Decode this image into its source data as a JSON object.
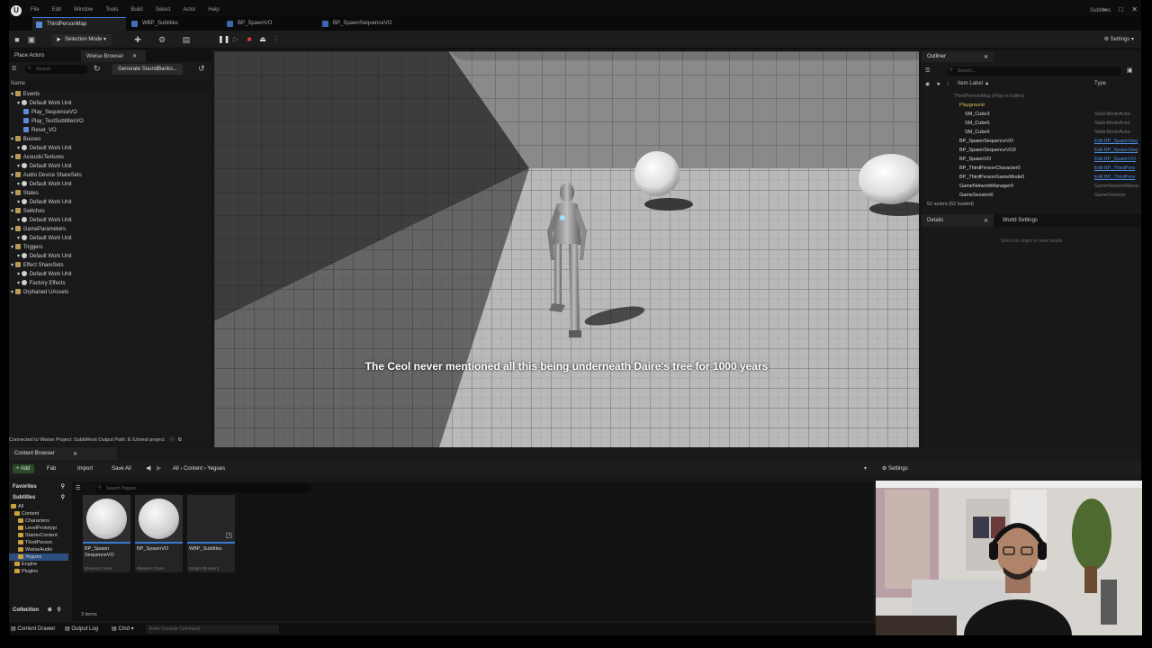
{
  "menubar": {
    "items": [
      "File",
      "Edit",
      "Window",
      "Tools",
      "Build",
      "Select",
      "Actor",
      "Help"
    ],
    "right_label": "Subtitles"
  },
  "tabs": [
    {
      "label": "ThirdPersonMap",
      "active": true
    },
    {
      "label": "WBP_Subtitles",
      "active": false
    },
    {
      "label": "BP_SpawnVO",
      "active": false
    },
    {
      "label": "BP_SpawnSequenceVO",
      "active": false
    }
  ],
  "toolbar": {
    "selection_mode": "Selection Mode",
    "settings_label": "Settings"
  },
  "left_panel": {
    "tab_place_actors": "Place Actors",
    "tab_wwise": "Wwise Browser",
    "search_placeholder": "Search",
    "generate_button": "Generate SoundBanks...",
    "column_name": "Name",
    "tree": [
      {
        "label": "Events",
        "depth": 0,
        "kind": "folder"
      },
      {
        "label": "Default Work Unit",
        "depth": 1,
        "kind": "wu"
      },
      {
        "label": "Play_SequenceVO",
        "depth": 2,
        "kind": "event"
      },
      {
        "label": "Play_TestSubtitlesVO",
        "depth": 2,
        "kind": "event"
      },
      {
        "label": "Reset_VO",
        "depth": 2,
        "kind": "event"
      },
      {
        "label": "Busses",
        "depth": 0,
        "kind": "folder"
      },
      {
        "label": "Default Work Unit",
        "depth": 1,
        "kind": "wu"
      },
      {
        "label": "AcousticTextures",
        "depth": 0,
        "kind": "folder"
      },
      {
        "label": "Default Work Unit",
        "depth": 1,
        "kind": "wu"
      },
      {
        "label": "Audio Device ShareSets",
        "depth": 0,
        "kind": "folder"
      },
      {
        "label": "Default Work Unit",
        "depth": 1,
        "kind": "wu"
      },
      {
        "label": "States",
        "depth": 0,
        "kind": "folder"
      },
      {
        "label": "Default Work Unit",
        "depth": 1,
        "kind": "wu"
      },
      {
        "label": "Switches",
        "depth": 0,
        "kind": "folder"
      },
      {
        "label": "Default Work Unit",
        "depth": 1,
        "kind": "wu"
      },
      {
        "label": "GameParameters",
        "depth": 0,
        "kind": "folder"
      },
      {
        "label": "Default Work Unit",
        "depth": 1,
        "kind": "wu"
      },
      {
        "label": "Triggers",
        "depth": 0,
        "kind": "folder"
      },
      {
        "label": "Default Work Unit",
        "depth": 1,
        "kind": "wu"
      },
      {
        "label": "Effect ShareSets",
        "depth": 0,
        "kind": "folder"
      },
      {
        "label": "Default Work Unit",
        "depth": 1,
        "kind": "wu"
      },
      {
        "label": "Factory Effects",
        "depth": 1,
        "kind": "wu"
      },
      {
        "label": "Orphaned UAssets",
        "depth": 0,
        "kind": "folder"
      }
    ],
    "connection_status": "Connected to Wwise Project: SubtitRoot Output Path: E:/Unreal project"
  },
  "viewport": {
    "subtitle": "The Ceol never mentioned all this being underneath Daire's tree for 1000 years"
  },
  "outliner": {
    "tab_label": "Outliner",
    "search_placeholder": "Search...",
    "col_label": "Item Label ▲",
    "col_type": "Type",
    "rows": [
      {
        "label": "ThirdPersonMap (Play in Editor)",
        "type": "",
        "indent": 1,
        "dim": true,
        "link": false
      },
      {
        "label": "Playground",
        "type": "",
        "indent": 2,
        "dim": false,
        "link": false
      },
      {
        "label": "SM_Cube3",
        "type": "StaticMeshActor",
        "indent": 3,
        "dim": false,
        "link": false
      },
      {
        "label": "SM_Cube5",
        "type": "StaticMeshActor",
        "indent": 3,
        "dim": false,
        "link": false
      },
      {
        "label": "SM_Cube6",
        "type": "StaticMeshActor",
        "indent": 3,
        "dim": false,
        "link": false
      },
      {
        "label": "BP_SpawnSequenceVO",
        "type": "Edit BP_SpawnSeq",
        "indent": 2,
        "dim": false,
        "link": true
      },
      {
        "label": "BP_SpawnSequenceVO2",
        "type": "Edit BP_SpawnSeq",
        "indent": 2,
        "dim": false,
        "link": true
      },
      {
        "label": "BP_SpawnVO",
        "type": "Edit BP_SpawnVO",
        "indent": 2,
        "dim": false,
        "link": true
      },
      {
        "label": "BP_ThirdPersonCharacter0",
        "type": "Edit BP_ThirdPers",
        "indent": 2,
        "dim": false,
        "link": true
      },
      {
        "label": "BP_ThirdPersonGameMode0",
        "type": "Edit BP_ThirdPers",
        "indent": 2,
        "dim": false,
        "link": true
      },
      {
        "label": "GameNetworkManager0",
        "type": "GameNetworkMana",
        "indent": 2,
        "dim": false,
        "link": false
      },
      {
        "label": "GameSession0",
        "type": "GameSession",
        "indent": 2,
        "dim": false,
        "link": false
      }
    ],
    "actor_count": "52 actors (52 loaded)"
  },
  "details": {
    "tab_details": "Details",
    "tab_world": "World Settings",
    "empty_message": "Select an object to view details"
  },
  "content_browser": {
    "title": "Content Browser",
    "add_label": "+ Add",
    "fab_label": "Fab",
    "import_label": "Import",
    "save_all_label": "Save All",
    "breadcrumbs": [
      "All",
      "Content",
      "Yegues"
    ],
    "settings_label": "Settings",
    "favorites_label": "Favorites",
    "project_label": "Subtitles",
    "folders": [
      {
        "label": "All",
        "depth": 0
      },
      {
        "label": "Content",
        "depth": 1
      },
      {
        "label": "Characters",
        "depth": 2
      },
      {
        "label": "LevelPrototypi",
        "depth": 2
      },
      {
        "label": "StarterContent",
        "depth": 2
      },
      {
        "label": "ThirdPerson",
        "depth": 2
      },
      {
        "label": "WwiseAudio",
        "depth": 2
      },
      {
        "label": "Yegues",
        "depth": 2,
        "selected": true
      },
      {
        "label": "Engine",
        "depth": 1
      },
      {
        "label": "Plugins",
        "depth": 1
      }
    ],
    "search_placeholder": "Search Yegues",
    "assets": [
      {
        "name": "BP_Spawn SequenceVO",
        "type": "Blueprint Class",
        "thumb": "sphere"
      },
      {
        "name": "BP_SpawnVO",
        "type": "Blueprint Class",
        "thumb": "sphere"
      },
      {
        "name": "WBP_Subtitles",
        "type": "Widget Blueprint",
        "thumb": "widget"
      }
    ],
    "items_count": "3 items",
    "collections_label": "Collection"
  },
  "statusbar": {
    "content_drawer": "Content Drawer",
    "output_log": "Output Log",
    "cmd": "Cmd",
    "console_placeholder": "Enter Console Command"
  }
}
